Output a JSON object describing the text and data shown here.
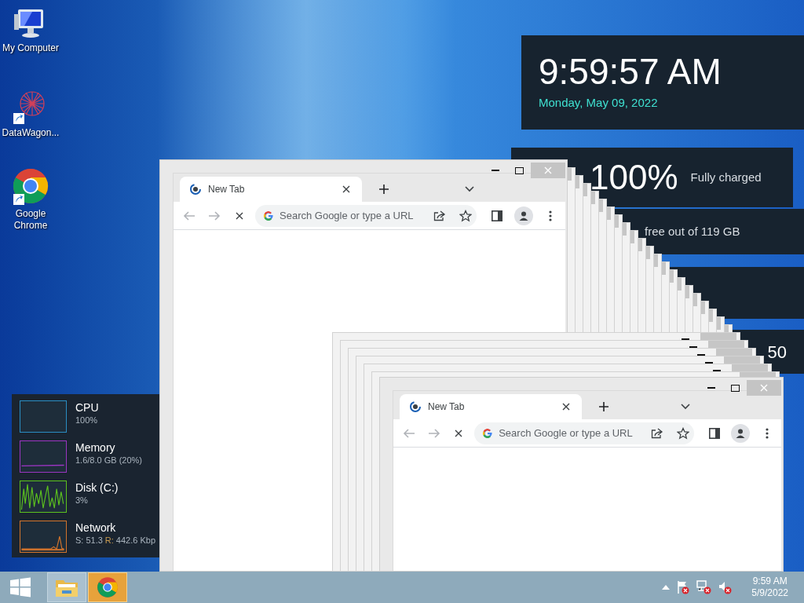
{
  "desktop_icons": [
    {
      "label": "My Computer",
      "kind": "computer"
    },
    {
      "label": "DataWagon...",
      "kind": "shortcut"
    },
    {
      "label": "Google Chrome",
      "kind": "chrome"
    }
  ],
  "clock_widget": {
    "time": "9:59:57 AM",
    "date": "Monday, May 09, 2022"
  },
  "battery_widget": {
    "percent": "100%",
    "status": "Fully charged"
  },
  "disk_widget": {
    "text": "free out of 119 GB"
  },
  "widget_4": {
    "text": "50"
  },
  "performance_widget": {
    "items": [
      {
        "name": "CPU",
        "reading": "100%",
        "color": "#2a8ec4",
        "kind": "flat"
      },
      {
        "name": "Memory",
        "reading": "1.6/8.0 GB (20%)",
        "color": "#9b35c2",
        "kind": "low"
      },
      {
        "name": "Disk (C:)",
        "reading": "3%",
        "color": "#5cc21e",
        "kind": "spiky"
      },
      {
        "name": "Network",
        "reading": "S: 51.3",
        "receive_label": "R:",
        "receive": "442.6 Kbp",
        "color": "#d2742c",
        "kind": "peak"
      }
    ]
  },
  "browser_windows": [
    {
      "tab_title": "New Tab",
      "address_placeholder": "Search Google or type a URL"
    },
    {
      "tab_title": "New Tab",
      "address_placeholder": "Search Google or type a URL"
    }
  ],
  "taskbar": {
    "apps": [
      {
        "kind": "explorer",
        "active": false
      },
      {
        "kind": "chrome",
        "active": true
      }
    ],
    "time": "9:59 AM",
    "date": "5/9/2022"
  }
}
